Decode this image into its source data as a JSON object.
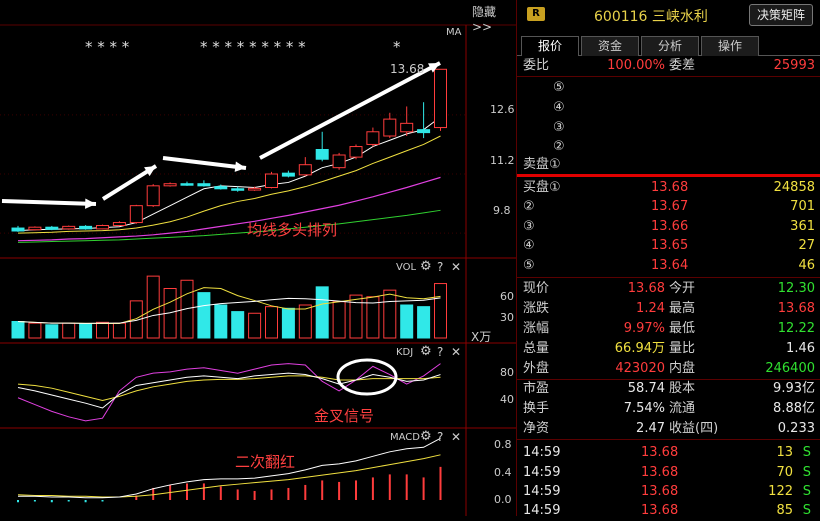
{
  "header": {
    "hide_label": "隐藏>>"
  },
  "chart": {
    "ma_label": "MA",
    "limit_up_marks_1": "* * * *",
    "limit_up_marks_2": "* * * * * * * * *",
    "limit_up_marks_3": "*",
    "price_ticks": [
      "12.6",
      "11.2",
      "9.8"
    ],
    "high_label": "13.68",
    "annotation_ma": "均线多头排列",
    "vol_title": "VOL",
    "vol_ticks": [
      "60",
      "30"
    ],
    "vol_unit": "X万",
    "kdj_title": "KDJ",
    "kdj_ticks": [
      "80",
      "40"
    ],
    "annotation_kdj": "金叉信号",
    "macd_title": "MACD",
    "macd_ticks": [
      "0.8",
      "0.4",
      "0.0"
    ],
    "annotation_macd": "二次翻红",
    "panel_icons": {
      "gear": "gear-icon",
      "help": "?",
      "close": "✕"
    },
    "colors": {
      "up": "#ff3c3c",
      "down": "#30e8e8",
      "ma5": "#ffffff",
      "ma10": "#f0e040",
      "ma20": "#e040e0",
      "ma60": "#30d030"
    }
  },
  "chart_data": {
    "type": "candlestick",
    "candles": [
      {
        "o": 9.92,
        "c": 9.85,
        "h": 9.97,
        "l": 9.83
      },
      {
        "o": 9.88,
        "c": 9.94,
        "h": 9.96,
        "l": 9.86
      },
      {
        "o": 9.94,
        "c": 9.89,
        "h": 9.97,
        "l": 9.87
      },
      {
        "o": 9.9,
        "c": 9.96,
        "h": 9.98,
        "l": 9.88
      },
      {
        "o": 9.96,
        "c": 9.9,
        "h": 9.99,
        "l": 9.88
      },
      {
        "o": 9.9,
        "c": 9.98,
        "h": 10.0,
        "l": 9.89
      },
      {
        "o": 9.98,
        "c": 10.05,
        "h": 10.08,
        "l": 9.96
      },
      {
        "o": 10.05,
        "c": 10.45,
        "h": 10.47,
        "l": 10.02
      },
      {
        "o": 10.45,
        "c": 10.92,
        "h": 10.96,
        "l": 10.42
      },
      {
        "o": 10.92,
        "c": 10.97,
        "h": 11.0,
        "l": 10.9
      },
      {
        "o": 10.97,
        "c": 10.95,
        "h": 11.02,
        "l": 10.92
      },
      {
        "o": 10.97,
        "c": 10.92,
        "h": 11.05,
        "l": 10.9
      },
      {
        "o": 10.9,
        "c": 10.85,
        "h": 10.95,
        "l": 10.83
      },
      {
        "o": 10.85,
        "c": 10.83,
        "h": 10.9,
        "l": 10.78
      },
      {
        "o": 10.82,
        "c": 10.86,
        "h": 10.9,
        "l": 10.8
      },
      {
        "o": 10.88,
        "c": 11.2,
        "h": 11.25,
        "l": 10.86
      },
      {
        "o": 11.22,
        "c": 11.15,
        "h": 11.28,
        "l": 11.12
      },
      {
        "o": 11.18,
        "c": 11.42,
        "h": 11.6,
        "l": 11.15
      },
      {
        "o": 11.78,
        "c": 11.55,
        "h": 12.2,
        "l": 11.5
      },
      {
        "o": 11.35,
        "c": 11.65,
        "h": 11.7,
        "l": 11.3
      },
      {
        "o": 11.6,
        "c": 11.85,
        "h": 11.9,
        "l": 11.55
      },
      {
        "o": 11.9,
        "c": 12.2,
        "h": 12.3,
        "l": 11.85
      },
      {
        "o": 12.1,
        "c": 12.5,
        "h": 12.65,
        "l": 12.05
      },
      {
        "o": 12.2,
        "c": 12.4,
        "h": 12.8,
        "l": 12.1
      },
      {
        "o": 12.25,
        "c": 12.18,
        "h": 12.9,
        "l": 12.05
      },
      {
        "o": 12.3,
        "c": 13.68,
        "h": 13.68,
        "l": 12.22
      }
    ],
    "ma5": [
      9.86,
      9.88,
      9.89,
      9.9,
      9.91,
      9.93,
      9.95,
      10.05,
      10.25,
      10.45,
      10.65,
      10.85,
      10.92,
      10.9,
      10.88,
      10.95,
      11.0,
      11.15,
      11.35,
      11.45,
      11.6,
      11.85,
      12.0,
      12.15,
      12.25,
      12.55
    ],
    "ma10": [
      9.8,
      9.81,
      9.82,
      9.84,
      9.85,
      9.86,
      9.88,
      9.92,
      9.99,
      10.07,
      10.18,
      10.32,
      10.45,
      10.55,
      10.62,
      10.72,
      10.8,
      10.9,
      11.02,
      11.15,
      11.28,
      11.45,
      11.6,
      11.75,
      11.9,
      12.1
    ],
    "ma20": [
      9.62,
      9.63,
      9.64,
      9.66,
      9.67,
      9.69,
      9.71,
      9.73,
      9.76,
      9.8,
      9.84,
      9.9,
      9.96,
      10.02,
      10.08,
      10.15,
      10.22,
      10.3,
      10.38,
      10.46,
      10.56,
      10.66,
      10.77,
      10.88,
      11.0,
      11.12
    ],
    "ma60": [
      9.58,
      9.59,
      9.6,
      9.61,
      9.62,
      9.63,
      9.64,
      9.66,
      9.68,
      9.7,
      9.72,
      9.74,
      9.77,
      9.8,
      9.83,
      9.86,
      9.9,
      9.94,
      9.98,
      10.02,
      10.07,
      10.12,
      10.17,
      10.22,
      10.28,
      10.34
    ],
    "volume": [
      20,
      18,
      16,
      18,
      17,
      19,
      18,
      45,
      75,
      60,
      70,
      55,
      40,
      32,
      30,
      38,
      36,
      40,
      62,
      44,
      52,
      50,
      58,
      40,
      38,
      66
    ],
    "vol_down": [
      true,
      false,
      true,
      false,
      true,
      false,
      false,
      false,
      false,
      false,
      false,
      true,
      true,
      true,
      false,
      false,
      true,
      false,
      true,
      false,
      false,
      false,
      false,
      true,
      true,
      false
    ],
    "kdj_k": [
      55,
      50,
      44,
      38,
      32,
      25,
      45,
      58,
      62,
      66,
      70,
      72,
      70,
      68,
      72,
      74,
      76,
      74,
      68,
      60,
      66,
      74,
      70,
      64,
      66,
      74
    ],
    "kdj_d": [
      60,
      58,
      54,
      48,
      42,
      36,
      42,
      50,
      56,
      60,
      64,
      66,
      67,
      67,
      68,
      70,
      72,
      72,
      70,
      66,
      66,
      68,
      68,
      68,
      68,
      70
    ],
    "kdj_j": [
      40,
      30,
      20,
      12,
      6,
      10,
      50,
      70,
      76,
      78,
      82,
      84,
      80,
      76,
      82,
      88,
      90,
      88,
      64,
      50,
      66,
      86,
      74,
      60,
      72,
      90
    ],
    "macd_dif": [
      0.05,
      0.05,
      0.04,
      0.04,
      0.03,
      0.03,
      0.04,
      0.08,
      0.15,
      0.2,
      0.24,
      0.27,
      0.28,
      0.28,
      0.29,
      0.32,
      0.35,
      0.4,
      0.46,
      0.48,
      0.52,
      0.58,
      0.64,
      0.68,
      0.7,
      0.82
    ],
    "macd_dea": [
      0.07,
      0.06,
      0.06,
      0.05,
      0.05,
      0.04,
      0.04,
      0.05,
      0.07,
      0.1,
      0.13,
      0.16,
      0.19,
      0.21,
      0.23,
      0.25,
      0.27,
      0.3,
      0.33,
      0.36,
      0.39,
      0.43,
      0.47,
      0.51,
      0.55,
      0.6
    ],
    "macd_bar": [
      -0.03,
      -0.02,
      -0.03,
      -0.02,
      -0.03,
      -0.02,
      0.0,
      0.06,
      0.16,
      0.2,
      0.22,
      0.22,
      0.18,
      0.14,
      0.12,
      0.14,
      0.16,
      0.2,
      0.26,
      0.24,
      0.26,
      0.3,
      0.34,
      0.34,
      0.3,
      0.44
    ]
  },
  "quote": {
    "badge": "R",
    "code": "600116",
    "name": "三峡水利",
    "decision_button": "决策矩阵",
    "tabs": [
      "报价",
      "资金",
      "分析",
      "操作"
    ],
    "weibi_label": "委比",
    "weibi_value": "100.00%",
    "weicha_label": "委差",
    "weicha_value": "25993",
    "sell": [
      {
        "label": "⑤",
        "price": "",
        "vol": ""
      },
      {
        "label": "④",
        "price": "",
        "vol": ""
      },
      {
        "label": "③",
        "price": "",
        "vol": ""
      },
      {
        "label": "②",
        "price": "",
        "vol": ""
      },
      {
        "label": "卖盘①",
        "price": "",
        "vol": ""
      }
    ],
    "buy": [
      {
        "label": "买盘①",
        "price": "13.68",
        "vol": "24858"
      },
      {
        "label": "②",
        "price": "13.67",
        "vol": "701"
      },
      {
        "label": "③",
        "price": "13.66",
        "vol": "361"
      },
      {
        "label": "④",
        "price": "13.65",
        "vol": "27"
      },
      {
        "label": "⑤",
        "price": "13.64",
        "vol": "46"
      }
    ],
    "stats": [
      {
        "l1": "现价",
        "v1": "13.68",
        "c1": "red",
        "l2": "今开",
        "v2": "12.30",
        "c2": "grn"
      },
      {
        "l1": "涨跌",
        "v1": "1.24",
        "c1": "red",
        "l2": "最高",
        "v2": "13.68",
        "c2": "red"
      },
      {
        "l1": "涨幅",
        "v1": "9.97%",
        "c1": "red",
        "l2": "最低",
        "v2": "12.22",
        "c2": "grn"
      },
      {
        "l1": "总量",
        "v1": "66.94万",
        "c1": "yel",
        "l2": "量比",
        "v2": "1.46",
        "c2": "wht"
      },
      {
        "l1": "外盘",
        "v1": "423020",
        "c1": "red",
        "l2": "内盘",
        "v2": "246400",
        "c2": "grn"
      }
    ],
    "fundamentals": [
      {
        "l1": "市盈",
        "v1": "58.74",
        "l2": "股本",
        "v2": "9.93亿"
      },
      {
        "l1": "换手",
        "v1": "7.54%",
        "l2": "流通",
        "v2": "8.88亿"
      },
      {
        "l1": "净资",
        "v1": "2.47",
        "l2": "收益(四)",
        "v2": "0.233"
      }
    ],
    "ticks": [
      {
        "time": "14:59",
        "price": "13.68",
        "vol": "13",
        "side": "S"
      },
      {
        "time": "14:59",
        "price": "13.68",
        "vol": "70",
        "side": "S"
      },
      {
        "time": "14:59",
        "price": "13.68",
        "vol": "122",
        "side": "S"
      },
      {
        "time": "14:59",
        "price": "13.68",
        "vol": "85",
        "side": "S"
      }
    ]
  }
}
